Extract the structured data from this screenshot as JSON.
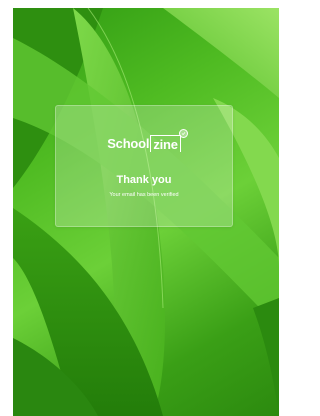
{
  "brand": {
    "logo_part1": "School",
    "logo_part2": "zine"
  },
  "message": {
    "title": "Thank you",
    "subtitle": "Your email has been verified"
  },
  "colors": {
    "background_green": "#4fbb22",
    "dark_green": "#2c8a0f",
    "card_overlay": "rgba(255,255,255,0.22)",
    "text": "#ffffff"
  },
  "icons": {
    "logo_badge": "check-badge-icon"
  }
}
